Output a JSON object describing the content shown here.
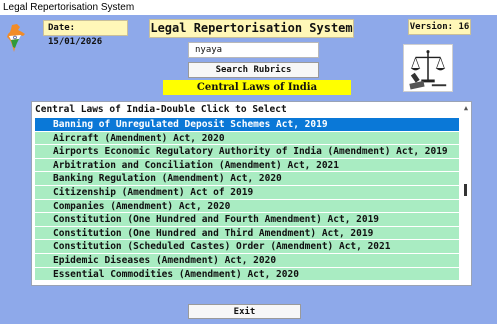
{
  "window": {
    "title": "Legal Repertorisation System"
  },
  "header": {
    "date": "Date: 15/01/2026",
    "app_title": "Legal Repertorisation System",
    "version": "Version: 16"
  },
  "search": {
    "value": "nyaya",
    "button_label": "Search Rubrics"
  },
  "section": {
    "title": "Central Laws of India"
  },
  "list": {
    "header": "Central Laws of India-Double Click to Select",
    "items": [
      "Banning of Unregulated Deposit Schemes Act, 2019",
      "Aircraft (Amendment) Act, 2020",
      "Airports Economic Regulatory Authority of India (Amendment) Act, 2019",
      "Arbitration and Conciliation (Amendment) Act, 2021",
      "Banking Regulation (Amendment) Act, 2020",
      "Citizenship (Amendment) Act of 2019",
      "Companies (Amendment) Act, 2020",
      "Constitution (One Hundred and Fourth Amendment) Act, 2019",
      "Constitution (One Hundred and Third Amendment) Act, 2019",
      "Constitution (Scheduled Castes) Order (Amendment) Act, 2021",
      "Epidemic Diseases (Amendment) Act, 2020",
      "Essential Commodities (Amendment) Act, 2020"
    ],
    "selected_index": 0
  },
  "footer": {
    "exit_label": "Exit"
  },
  "colors": {
    "background": "#8ea9ea",
    "label_bg": "#fff7b8",
    "banner": "#ffff00",
    "list_item": "#a9ecc2",
    "selected": "#0a78d7"
  },
  "icons": {
    "emblem": "india-map-icon",
    "logo": "scales-of-justice-icon"
  }
}
